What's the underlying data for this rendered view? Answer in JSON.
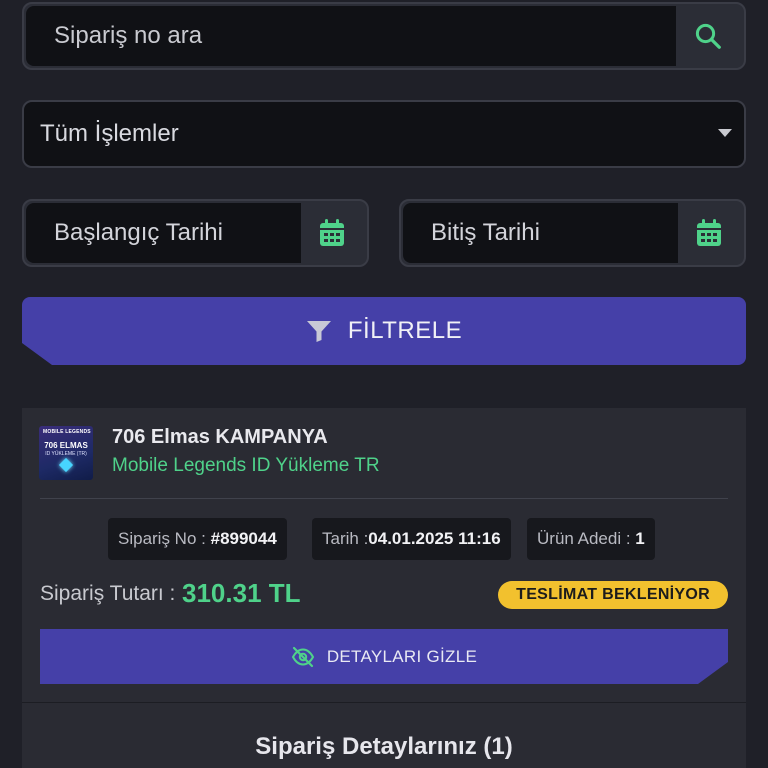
{
  "search": {
    "placeholder": "Sipariş no ara",
    "icon": "search-icon"
  },
  "filter_select": {
    "selected": "Tüm İşlemler"
  },
  "date_start": {
    "placeholder": "Başlangıç Tarihi",
    "icon": "calendar-icon"
  },
  "date_end": {
    "placeholder": "Bitiş Tarihi",
    "icon": "calendar-icon"
  },
  "filter_button": {
    "label": "FİLTRELE",
    "icon": "filter-icon"
  },
  "order": {
    "thumbnail": {
      "brand": "MOBILE LEGENDS",
      "headline": "706 ELMAS",
      "subline": "ID YÜKLEME (TR)"
    },
    "title": "706 Elmas KAMPANYA",
    "subtitle": "Mobile Legends ID Yükleme TR",
    "order_no_label": "Sipariş No :",
    "order_no": "#899044",
    "date_label": "Tarih :",
    "date": "04.01.2025 11:16",
    "qty_label": "Ürün Adedi :",
    "qty": "1",
    "amount_label": "Sipariş Tutarı :",
    "amount": "310.31 TL",
    "status": "TESLİMAT BEKLENİYOR",
    "details_button": "DETAYLARI GİZLE",
    "details_title": "Sipariş Detaylarınız (1)"
  },
  "colors": {
    "background": "#1f2028",
    "accent": "#4540a8",
    "success": "#4fd28a",
    "warning": "#f2c12e"
  }
}
